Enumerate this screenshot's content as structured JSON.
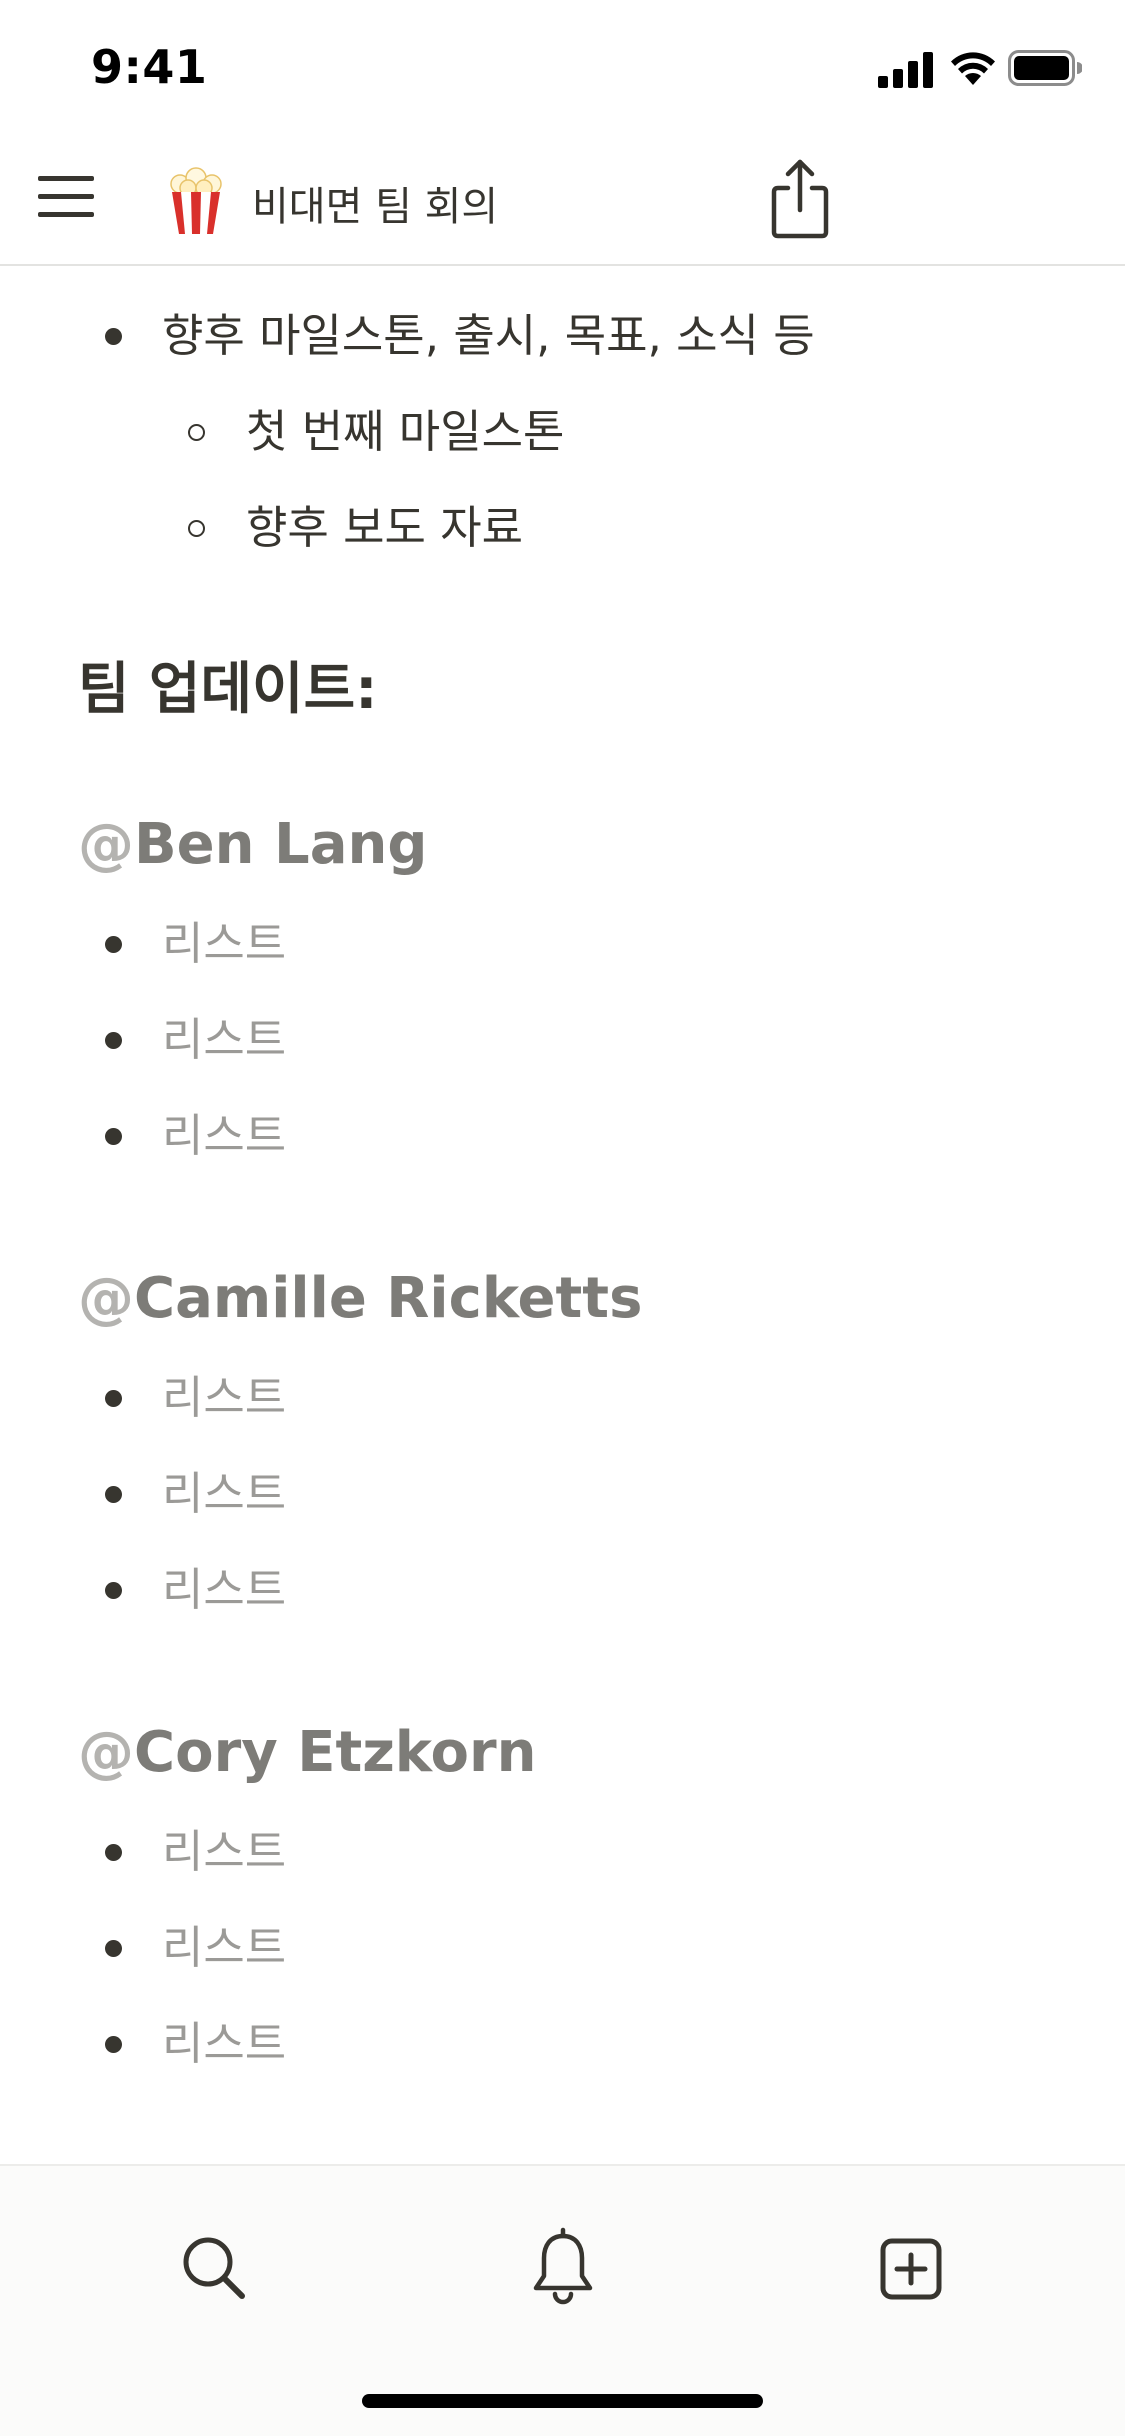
{
  "status_bar": {
    "time": "9:41"
  },
  "nav": {
    "page_title": "비대면 팀 회의",
    "emoji_icon": "popcorn-icon"
  },
  "content": {
    "bullets_top": {
      "item": "향후 마일스톤, 출시, 목표, 소식 등",
      "subitems": [
        "첫 번째 마일스톤",
        "향후 보도 자료"
      ]
    },
    "team_heading": "팀 업데이트:",
    "members": [
      {
        "at": "@",
        "name": "Ben Lang",
        "items": [
          "리스트",
          "리스트",
          "리스트"
        ]
      },
      {
        "at": "@",
        "name": "Camille Ricketts",
        "items": [
          "리스트",
          "리스트",
          "리스트"
        ]
      },
      {
        "at": "@",
        "name": "Cory Etzkorn",
        "items": [
          "리스트",
          "리스트",
          "리스트"
        ]
      }
    ]
  },
  "toolbar": {
    "icons": [
      "search-icon",
      "bell-icon",
      "new-page-icon"
    ]
  },
  "colors": {
    "text": "#37352f",
    "muted_text": "#9b9a97",
    "mention": "#7d7c78",
    "divider": "#e3e3e1"
  }
}
